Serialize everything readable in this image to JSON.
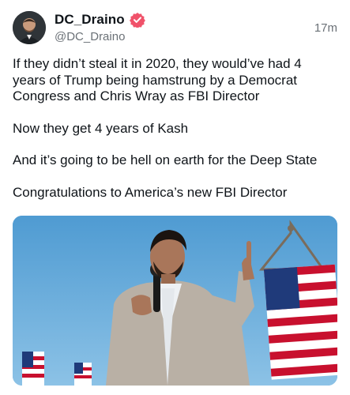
{
  "author": {
    "display_name": "DC_Draino",
    "handle": "@DC_Draino",
    "verified_icon": "verified-badge-icon",
    "avatar_icon": "avatar-photo"
  },
  "post": {
    "time": "17m",
    "paragraphs": [
      "If they didn’t steal it in 2020, they would’ve had 4 years of Trump being hamstrung by a Democrat Congress and Chris Wray as FBI Director",
      "Now they get 4 years of Kash",
      "And it’s going to be hell on earth for the Deep State",
      "Congratulations to America’s new FBI Director"
    ],
    "media": {
      "type": "photo",
      "subject": "man-speaking-into-microphone-with-american-flag"
    }
  },
  "colors": {
    "badge": "#f0526a",
    "secondary_text": "#6b7177",
    "sky": "#5fa7d8"
  }
}
